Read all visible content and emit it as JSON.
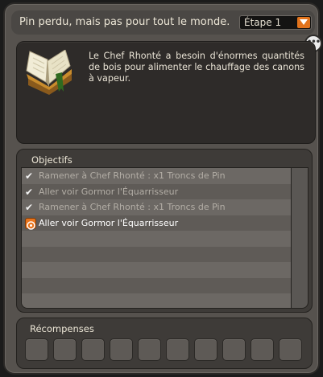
{
  "header": {
    "quest_title": "Pin perdu, mais pas pour tout le monde.",
    "step_value": "Étape 1"
  },
  "description": {
    "text": "Le Chef Rhonté a besoin d'énormes quantités de bois pour alimenter le chauffage des canons à vapeur."
  },
  "objectives": {
    "title": "Objectifs",
    "items": [
      {
        "label": "Ramener à Chef Rhonté : x1 Troncs de Pin",
        "status": "done",
        "icon": "check-icon"
      },
      {
        "label": "Aller voir Gormor l'Équarrisseur",
        "status": "done",
        "icon": "check-icon"
      },
      {
        "label": "Ramener à Chef Rhonté : x1 Troncs de Pin",
        "status": "done",
        "icon": "check-icon"
      },
      {
        "label": "Aller voir Gormor l'Équarrisseur",
        "status": "active",
        "icon": "target-icon"
      }
    ]
  },
  "rewards": {
    "title": "Récompenses",
    "slot_count": 10
  },
  "colors": {
    "accent": "#e2731c",
    "panel": "#56524e",
    "description_bg": "#2e2b29"
  }
}
